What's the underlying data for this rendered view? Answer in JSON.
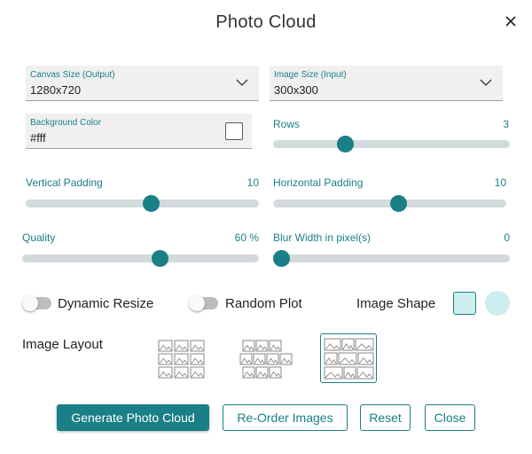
{
  "dialog": {
    "title": "Photo Cloud"
  },
  "canvas_size": {
    "label": "Canvas Size (Output)",
    "value": "1280x720"
  },
  "image_size": {
    "label": "Image Size (Input)",
    "value": "300x300"
  },
  "background_color": {
    "label": "Background Color",
    "value": "#fff"
  },
  "sliders": {
    "rows": {
      "label": "Rows",
      "value": "3",
      "position": 0.29
    },
    "vertical_padding": {
      "label": "Vertical Padding",
      "value": "10",
      "position": 0.54
    },
    "horizontal_padding": {
      "label": "Horizontal Padding",
      "value": "10",
      "position": 0.54
    },
    "quality": {
      "label": "Quality",
      "value": "60 %",
      "position": 0.59
    },
    "blur_width": {
      "label": "Blur Width in pixel(s)",
      "value": "0",
      "position": 0.0
    }
  },
  "toggles": {
    "dynamic_resize": {
      "label": "Dynamic Resize",
      "on": false
    },
    "random_plot": {
      "label": "Random Plot",
      "on": false
    }
  },
  "image_shape": {
    "label": "Image Shape",
    "selected": "square"
  },
  "image_layout": {
    "label": "Image Layout",
    "selected_index": 2
  },
  "buttons": {
    "generate": "Generate Photo Cloud",
    "reorder": "Re-Order Images",
    "reset": "Reset",
    "close": "Close"
  },
  "colors": {
    "accent": "#1a7f86",
    "track": "#d3dadc",
    "field_bg": "#f0f0f0",
    "shape_fill": "#cdeeee"
  }
}
